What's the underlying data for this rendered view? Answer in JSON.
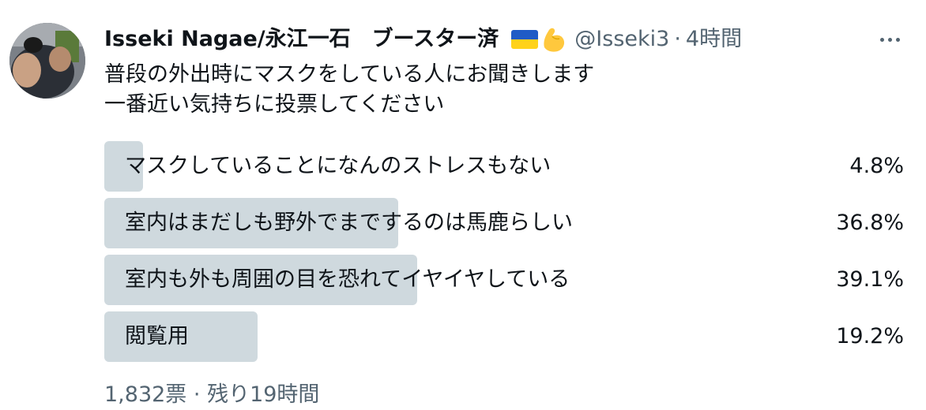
{
  "author": {
    "display_name": "Isseki Nagae/永江一石　ブースター済",
    "handle": "@Isseki3",
    "separator": "·",
    "time": "4時間",
    "flag_icon": "ukraine-flag-icon",
    "muscle_icon": "flexed-biceps-icon"
  },
  "tweet": {
    "line1": "普段の外出時にマスクをしている人にお聞きします",
    "line2": "一番近い気持ちに投票してください"
  },
  "poll": {
    "options": [
      {
        "label": "マスクしていることになんのストレスもない",
        "percent": "4.8%",
        "share": 0.048
      },
      {
        "label": "室内はまだしも野外でまでするのは馬鹿らしい",
        "percent": "36.8%",
        "share": 0.368
      },
      {
        "label": "室内も外も周囲の目を恐れてイヤイヤしている",
        "percent": "39.1%",
        "share": 0.391
      },
      {
        "label": "閲覧用",
        "percent": "19.2%",
        "share": 0.192
      }
    ],
    "votes": "1,832票",
    "separator": "·",
    "remaining": "残り19時間"
  },
  "colors": {
    "bar": "#cfd9de",
    "text": "#0f1419",
    "secondary": "#536471"
  },
  "icons": {
    "more": "more-horizontal-icon"
  }
}
